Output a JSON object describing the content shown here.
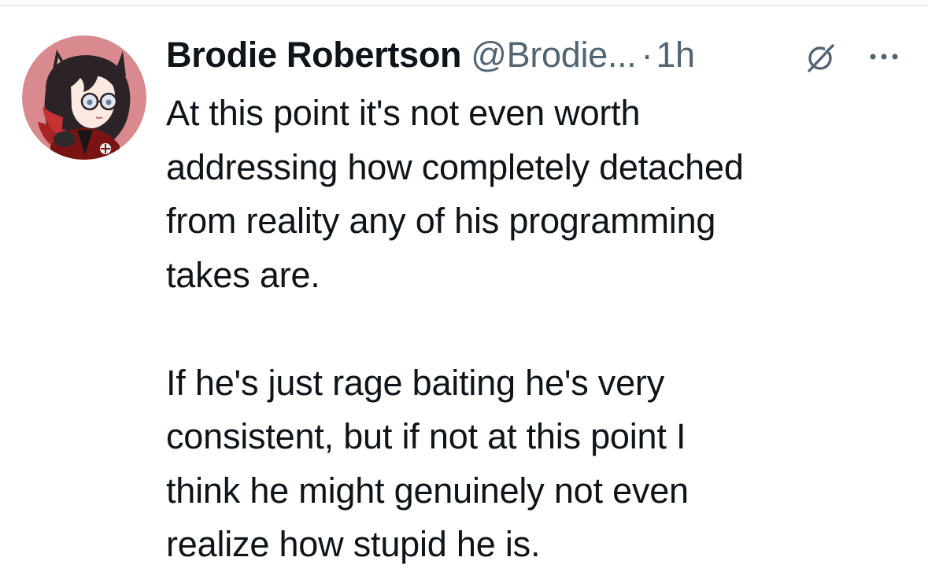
{
  "tweet": {
    "author": {
      "display_name": "Brodie Robertson",
      "handle": "@Brodie...",
      "avatar_icon": "anime-avatar"
    },
    "separator": "·",
    "timestamp": "1h",
    "icons": {
      "grok": "grok-icon",
      "more": "more-options-icon"
    },
    "paragraphs": [
      {
        "lines": [
          "At this point it's not even worth",
          "addressing how completely detached",
          "from reality any of his programming",
          "takes are."
        ]
      },
      {
        "lines": [
          "If he's just rage baiting he's very",
          "consistent, but if not at this point I",
          "think he might genuinely not even",
          "realize how stupid he is."
        ]
      }
    ]
  },
  "colors": {
    "primary_text": "#0f1419",
    "secondary_text": "#536471",
    "divider": "#e7e9ea",
    "avatar_bg": "#d98a8f"
  }
}
